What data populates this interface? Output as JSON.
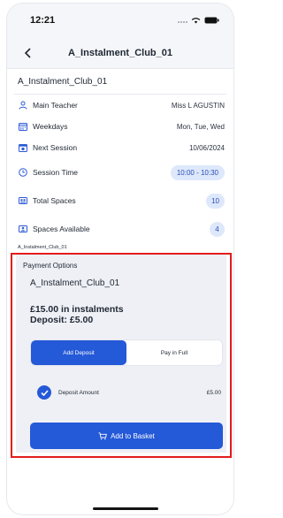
{
  "status_bar": {
    "time": "12:21"
  },
  "nav": {
    "title": "A_Instalment_Club_01"
  },
  "club": {
    "title": "A_Instalment_Club_01",
    "rows": [
      {
        "label": "Main Teacher",
        "value": "Miss L AGUSTIN",
        "icon": "person-icon"
      },
      {
        "label": "Weekdays",
        "value": "Mon, Tue, Wed",
        "icon": "calendar-grid-icon"
      },
      {
        "label": "Next Session",
        "value": "10/06/2024",
        "icon": "calendar-day-icon"
      },
      {
        "label": "Session Time",
        "value": "10:00 - 10:30",
        "icon": "clock-icon"
      },
      {
        "label": "Total Spaces",
        "value": "10",
        "icon": "grid-seat-icon"
      },
      {
        "label": "Spaces Available",
        "value": "4",
        "icon": "seat-available-icon"
      }
    ],
    "footer_name": "A_Instalment_Club_01"
  },
  "payment": {
    "heading": "Payment Options",
    "club_name": "A_Instalment_Club_01",
    "price_line": "£15.00 in instalments",
    "deposit_line": "Deposit: £5.00",
    "tabs": [
      {
        "label": "Add Deposit",
        "active": true
      },
      {
        "label": "Pay in Full",
        "active": false
      }
    ],
    "deposit_label": "Deposit Amount",
    "deposit_amount": "£5.00",
    "basket_label": "Add to Basket"
  },
  "colors": {
    "accent": "#2459d8",
    "highlight_border": "#e31c1c",
    "pill_bg": "#dde8fb"
  }
}
